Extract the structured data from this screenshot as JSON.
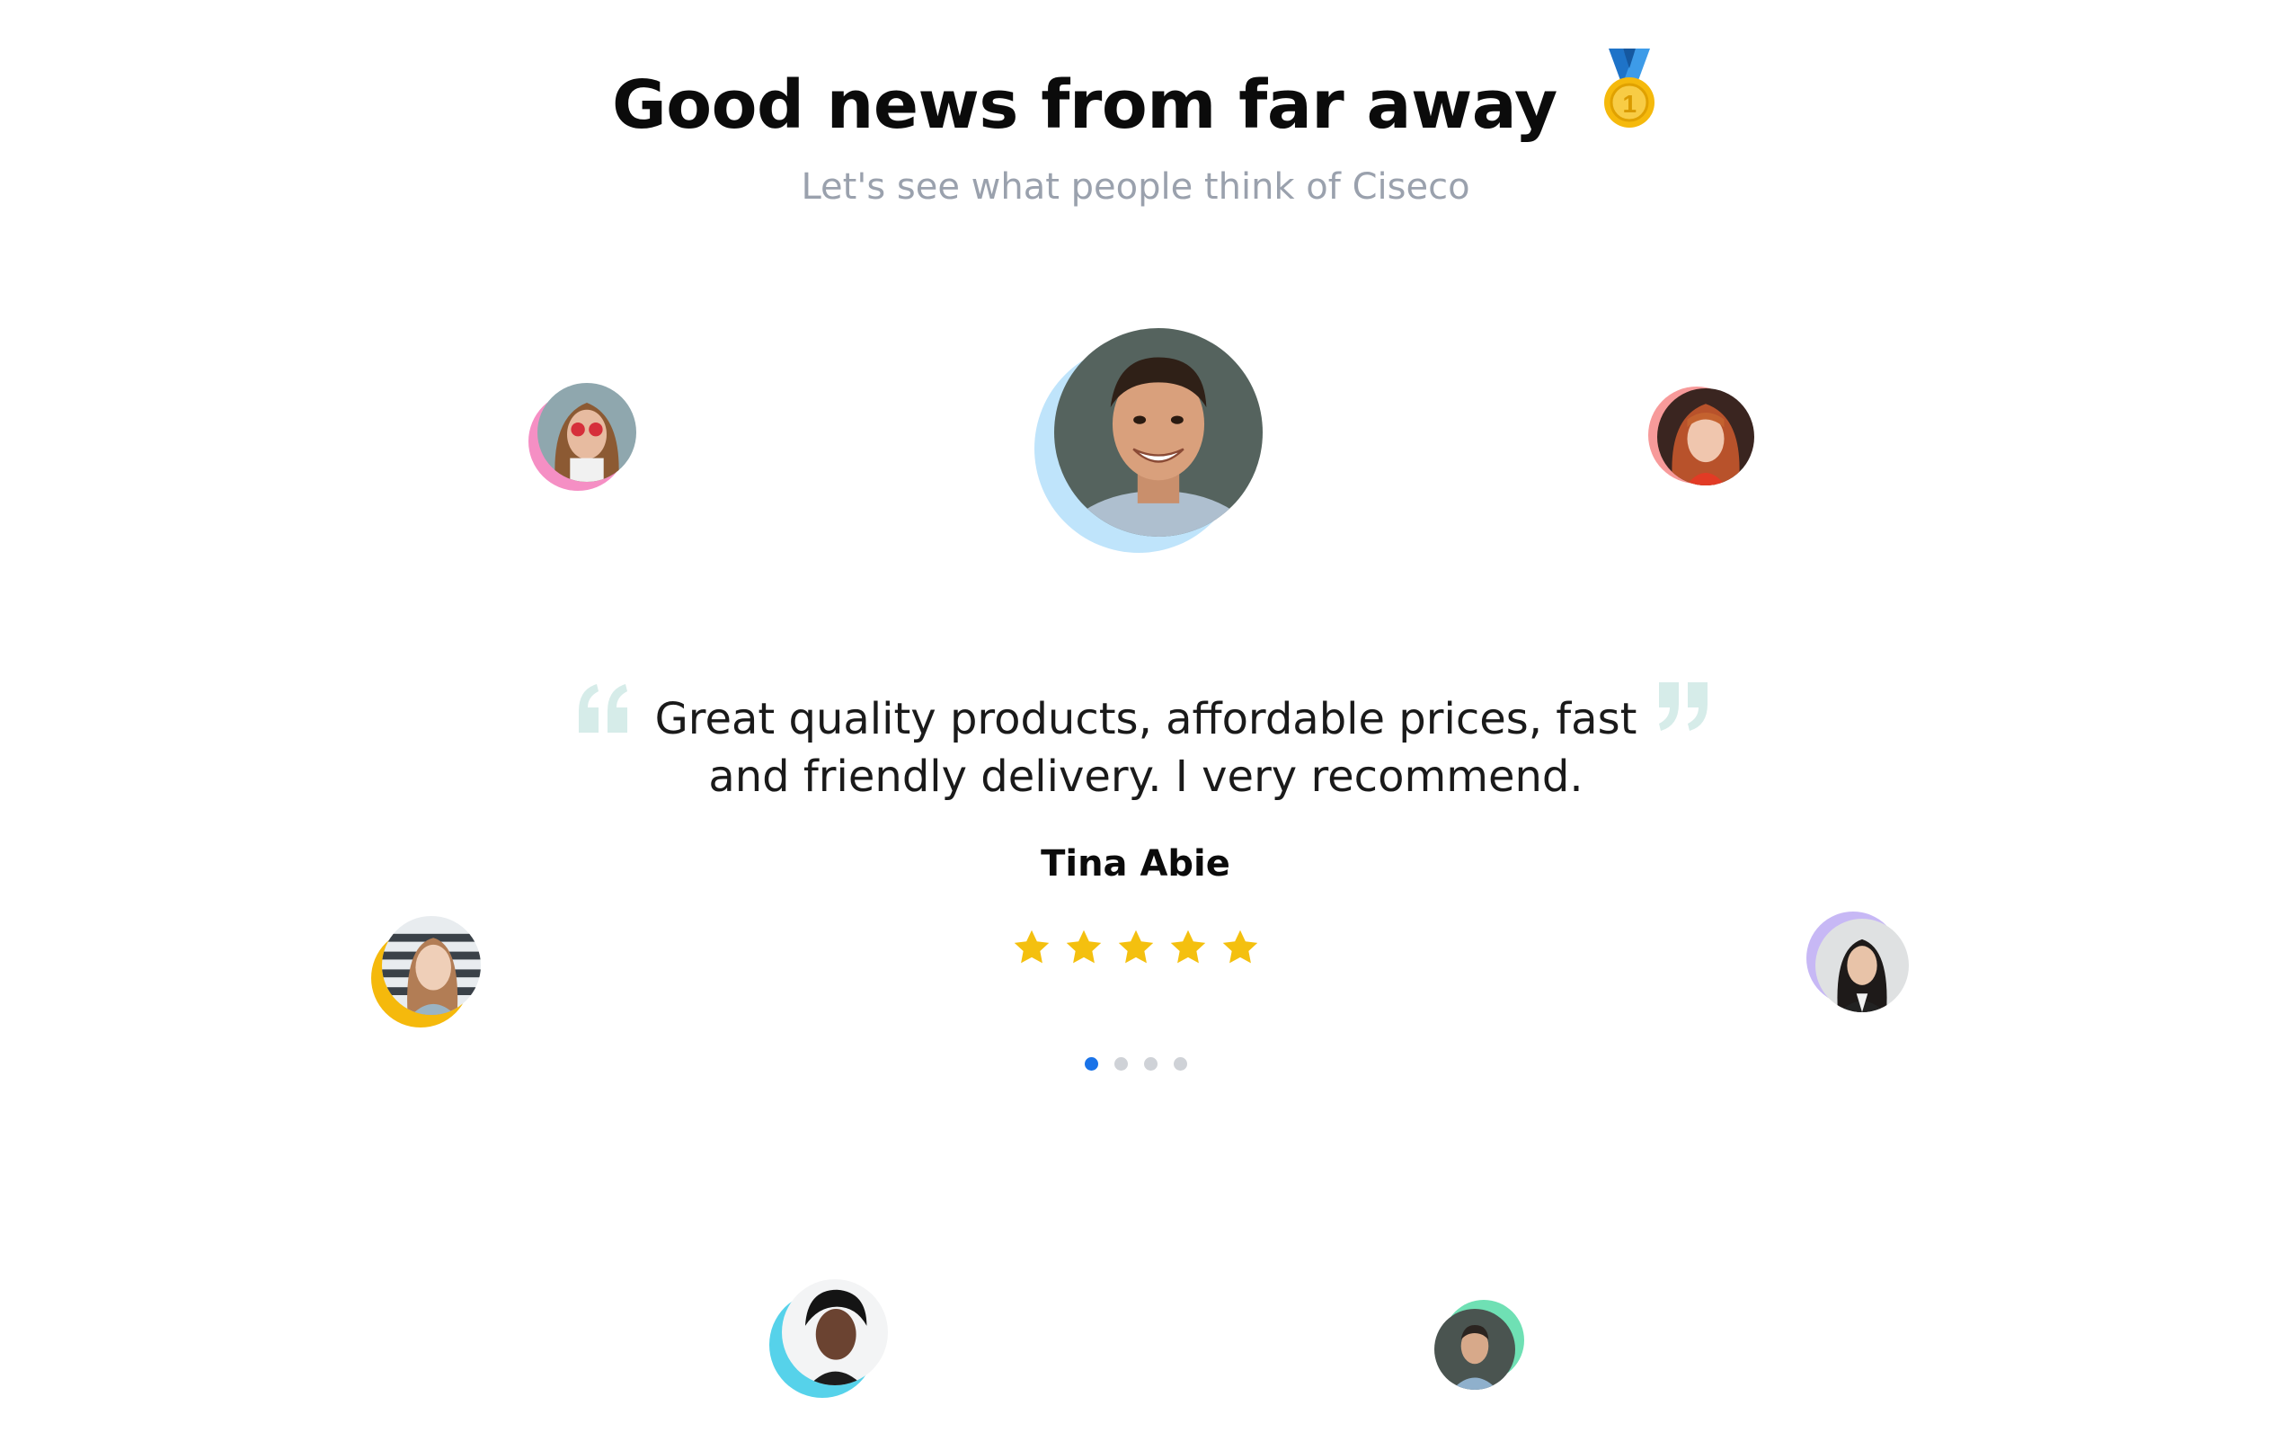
{
  "header": {
    "title": "Good news from far away",
    "subtitle": "Let's see what people think of Ciseco"
  },
  "testimonial": {
    "quote": "Great quality products, affordable prices, fast and friendly delivery. I very recommend.",
    "author": "Tina Abie",
    "rating": 5,
    "rating_max": 5
  },
  "pagination": {
    "total": 4,
    "active_index": 0
  },
  "colors": {
    "star": "#f4c00f",
    "active_dot": "#1a73e8",
    "inactive_dot": "#cfd2d7",
    "quote_mark": "#d6ece9",
    "subtitle": "#9aa1ad",
    "ring_main": "#bfe4fb",
    "ring_pink": "#f58fc4",
    "ring_red": "#f79a9a",
    "ring_yellow": "#f5b90c",
    "ring_purple": "#c7b8f5",
    "ring_cyan": "#56d2ea",
    "ring_green": "#6fe0b4"
  },
  "icons": {
    "title_emoji": "medal-icon",
    "open_quote": "open-quote-icon",
    "close_quote": "close-quote-icon",
    "rating": "star-icon"
  }
}
